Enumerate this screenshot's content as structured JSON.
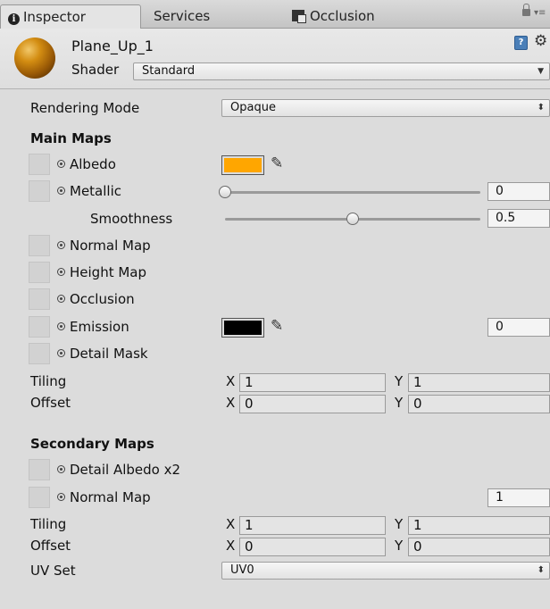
{
  "tabs": [
    {
      "label": "Inspector",
      "icon": "info-icon"
    },
    {
      "label": "Services"
    },
    {
      "label": "Occlusion",
      "icon": "occlusion-icon"
    }
  ],
  "header": {
    "object_name": "Plane_Up_1",
    "shader_label": "Shader",
    "shader_value": "Standard"
  },
  "rendering": {
    "label": "Rendering Mode",
    "value": "Opaque"
  },
  "main_maps": {
    "title": "Main Maps",
    "albedo": {
      "label": "Albedo",
      "color": "#ffa600"
    },
    "metallic": {
      "label": "Metallic",
      "value": "0",
      "level": 0
    },
    "smoothness": {
      "label": "Smoothness",
      "value": "0.5",
      "level": 0.5
    },
    "normal": {
      "label": "Normal Map"
    },
    "height": {
      "label": "Height Map"
    },
    "occlusion": {
      "label": "Occlusion"
    },
    "emission": {
      "label": "Emission",
      "color": "#000000",
      "value": "0"
    },
    "detail_mask": {
      "label": "Detail Mask"
    },
    "tiling": {
      "label": "Tiling",
      "x_label": "X",
      "x": "1",
      "y_label": "Y",
      "y": "1"
    },
    "offset": {
      "label": "Offset",
      "x_label": "X",
      "x": "0",
      "y_label": "Y",
      "y": "0"
    }
  },
  "secondary_maps": {
    "title": "Secondary Maps",
    "detail_albedo": {
      "label": "Detail Albedo x2"
    },
    "normal": {
      "label": "Normal Map",
      "value": "1"
    },
    "tiling": {
      "label": "Tiling",
      "x_label": "X",
      "x": "1",
      "y_label": "Y",
      "y": "1"
    },
    "offset": {
      "label": "Offset",
      "x_label": "X",
      "x": "0",
      "y_label": "Y",
      "y": "0"
    },
    "uv_set": {
      "label": "UV Set",
      "value": "UV0"
    }
  }
}
